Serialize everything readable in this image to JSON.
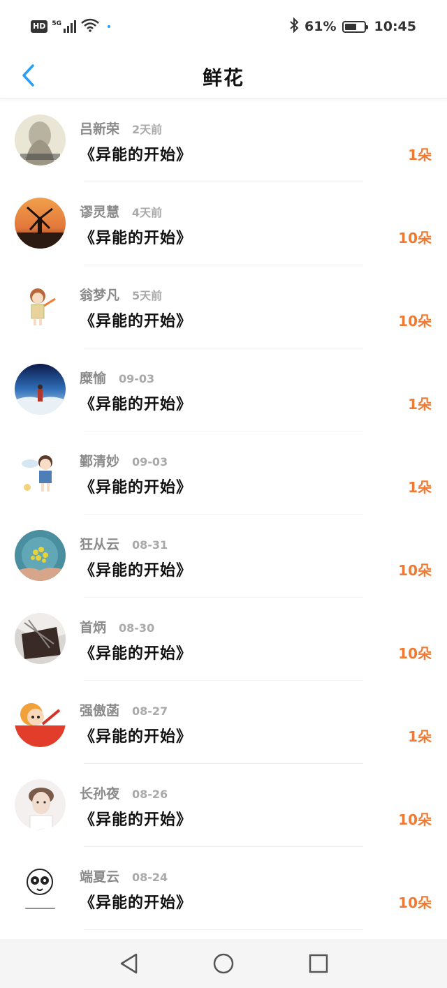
{
  "status_bar": {
    "hd_badge": "HD",
    "network": "5G",
    "battery_text": "61%",
    "battery_level": 0.61,
    "time": "10:45",
    "icons": [
      "signal-icon",
      "wifi-icon",
      "bluetooth-icon",
      "battery-icon"
    ]
  },
  "header": {
    "title": "鲜花",
    "back_icon": "chevron-left-icon"
  },
  "colors": {
    "accent_blue": "#2a9df4",
    "amount_orange": "#f07a33",
    "name_gray": "#8a8a8a",
    "time_gray": "#a9a9a9",
    "title_black": "#111111"
  },
  "gifts": [
    {
      "name": "吕新荣",
      "time": "2天前",
      "book": "《异能的开始》",
      "amount": "1朵"
    },
    {
      "name": "谬灵慧",
      "time": "4天前",
      "book": "《异能的开始》",
      "amount": "10朵"
    },
    {
      "name": "翁梦凡",
      "time": "5天前",
      "book": "《异能的开始》",
      "amount": "10朵"
    },
    {
      "name": "糜愉",
      "time": "09-03",
      "book": "《异能的开始》",
      "amount": "1朵"
    },
    {
      "name": "鄞清妙",
      "time": "09-03",
      "book": "《异能的开始》",
      "amount": "1朵"
    },
    {
      "name": "狂从云",
      "time": "08-31",
      "book": "《异能的开始》",
      "amount": "10朵"
    },
    {
      "name": "首炳",
      "time": "08-30",
      "book": "《异能的开始》",
      "amount": "10朵"
    },
    {
      "name": "强傲菡",
      "time": "08-27",
      "book": "《异能的开始》",
      "amount": "1朵"
    },
    {
      "name": "长孙夜",
      "time": "08-26",
      "book": "《异能的开始》",
      "amount": "10朵"
    },
    {
      "name": "端夏云",
      "time": "08-24",
      "book": "《异能的开始》",
      "amount": "10朵"
    }
  ],
  "nav_bar": {
    "buttons": [
      "back-triangle-icon",
      "home-circle-icon",
      "recents-square-icon"
    ]
  }
}
